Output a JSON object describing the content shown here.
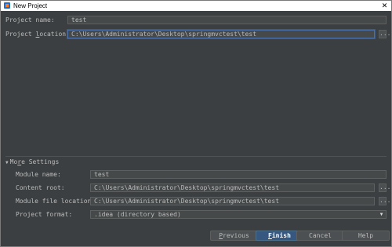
{
  "window": {
    "title": "New Project",
    "close_glyph": "✕"
  },
  "project_name": {
    "label": "Project name:",
    "value": "test"
  },
  "project_location": {
    "label": "Project location:",
    "value": "C:\\Users\\Administrator\\Desktop\\springmvctest\\test",
    "browse": "..."
  },
  "more_settings": {
    "label": "More Settings",
    "expanded": true
  },
  "module_name": {
    "label": "Module name:",
    "value": "test"
  },
  "content_root": {
    "label": "Content root:",
    "value": "C:\\Users\\Administrator\\Desktop\\springmvctest\\test",
    "browse": "..."
  },
  "module_file_location": {
    "label": "Module file location:",
    "value": "C:\\Users\\Administrator\\Desktop\\springmvctest\\test",
    "browse": "..."
  },
  "project_format": {
    "label": "Project format:",
    "value": ".idea (directory based)",
    "arrow": "▼"
  },
  "buttons": {
    "previous": "Previous",
    "finish": "Finish",
    "cancel": "Cancel",
    "help": "Help"
  },
  "colors": {
    "background": "#3c3f41",
    "field": "#45494a",
    "accent": "#365880",
    "focus": "#4a6ea8"
  }
}
